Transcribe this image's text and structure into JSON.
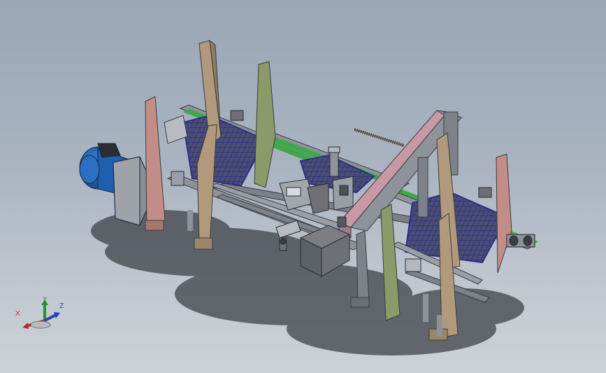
{
  "viewport": {
    "background_top": "#9aa6b6",
    "background_bottom": "#cdd2d8"
  },
  "model": {
    "colors": {
      "frame_steel": "#8e939b",
      "frame_dark": "#5d6168",
      "green_belt": "#3fa84a",
      "mesh_blue": "#3d3f9a",
      "motor_blue": "#1f5fb0",
      "upright_tan": "#b19a7c",
      "upright_pink": "#c28d86",
      "upright_olive": "#8a9a68",
      "beam_pink": "#c899a5",
      "motor_gray": "#6e7075",
      "shadow": "#3f434a"
    }
  },
  "triad": {
    "x_label": "X",
    "y_label": "Y",
    "z_label": "Z",
    "x_color": "#c0262c",
    "y_color": "#2c8c35",
    "z_color": "#2a3fb8"
  }
}
